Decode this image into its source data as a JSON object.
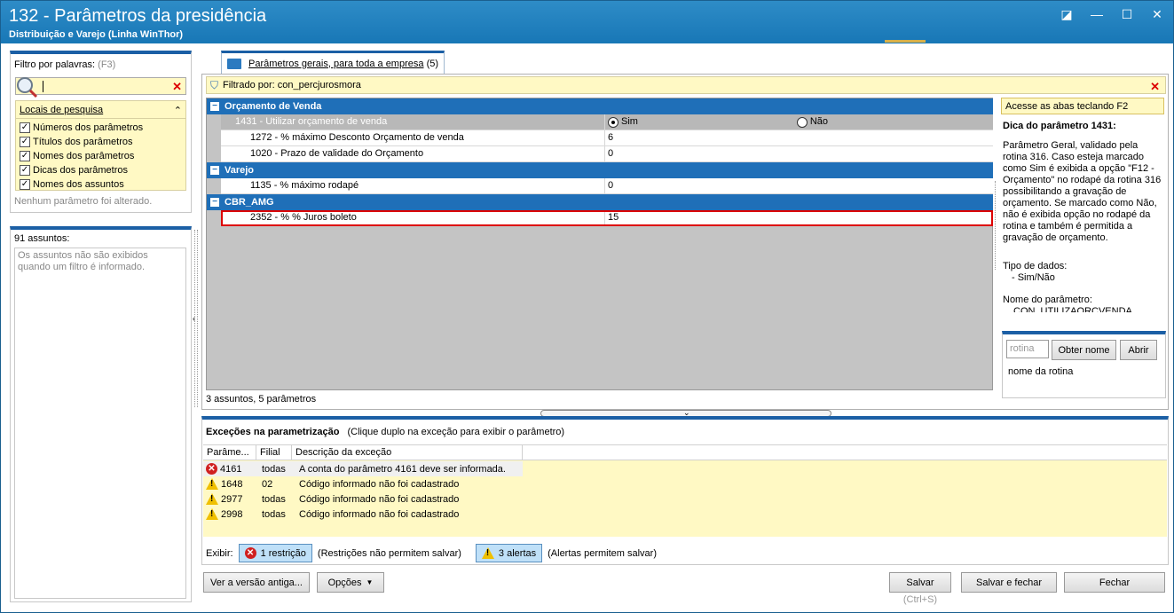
{
  "window": {
    "title": "132 - Parâmetros da presidência",
    "subtitle": "Distribuição e Varejo (Linha WinThor)"
  },
  "left": {
    "filter_label": "Filtro por palavras:",
    "filter_shortcut": "(F3)",
    "search_value": "",
    "locais_title": "Locais de pesquisa",
    "locais_items": [
      "Números dos parâmetros",
      "Títulos dos parâmetros",
      "Nomes dos parâmetros",
      "Dicas dos parâmetros",
      "Nomes dos assuntos"
    ],
    "status": "Nenhum parâmetro foi alterado.",
    "assuntos_label": "91 assuntos:",
    "assuntos_msg": "Os assuntos não são exibidos quando um filtro é informado."
  },
  "tab": {
    "label": "Parâmetros gerais, para toda a empresa",
    "count": "(5)"
  },
  "filter": {
    "text": "Filtrado por: con_percjurosmora"
  },
  "grid": {
    "groups": [
      {
        "name": "Orçamento  de Venda"
      },
      {
        "name": "Varejo"
      },
      {
        "name": "CBR_AMG"
      }
    ],
    "rows": [
      {
        "name": "1431 - Utilizar orçamento de venda",
        "val": ""
      },
      {
        "name": "1272 - % máximo Desconto Orçamento de venda",
        "val": "6"
      },
      {
        "name": "1020 - Prazo de validade do Orçamento",
        "val": "0"
      },
      {
        "name": "1135 - % máximo rodapé",
        "val": "0"
      },
      {
        "name": "2352 - % % Juros boleto",
        "val": "15"
      }
    ],
    "radio_sim": "Sim",
    "radio_nao": "Não",
    "footer": "3 assuntos, 5 parâmetros"
  },
  "hint": {
    "access": "Acesse as abas teclando F2",
    "title": "Dica do parâmetro 1431:",
    "body": "Parâmetro Geral, validado pela rotina 316. Caso esteja marcado como Sim é exibida a opção \"F12 - Orçamento\" no rodapé da rotina 316 possibilitando a gravação de orçamento. Se marcado como Não, não é exibida opção no rodapé da rotina e também é permitida a gravação de orçamento.",
    "tipo_label": "Tipo de dados:",
    "tipo_value": "- Sim/Não",
    "nome_label": "Nome do parâmetro:",
    "nome_value": "CON_UTILIZAORCVENDA"
  },
  "rotina": {
    "placeholder": "rotina",
    "obter_button": "Obter nome",
    "abrir_button": "Abrir",
    "nome_label": "nome da rotina"
  },
  "exceptions": {
    "title": "Exceções na parametrização",
    "hint": "(Clique duplo na exceção para exibir o parâmetro)",
    "columns": [
      "Parâme...",
      "Filial",
      "Descrição da exceção"
    ],
    "rows": [
      {
        "type": "error",
        "param": "4161",
        "filial": "todas",
        "desc": "A conta do parâmetro 4161 deve ser informada."
      },
      {
        "type": "warning",
        "param": "1648",
        "filial": "02",
        "desc": "Código informado não foi cadastrado"
      },
      {
        "type": "warning",
        "param": "2977",
        "filial": "todas",
        "desc": "Código informado não foi cadastrado"
      },
      {
        "type": "warning",
        "param": "2998",
        "filial": "todas",
        "desc": "Código informado não foi cadastrado"
      }
    ],
    "exibir_label": "Exibir:",
    "restricao_button": "1 restrição",
    "restricao_note": "(Restrições não permitem salvar)",
    "alertas_button": "3 alertas",
    "alertas_note": "(Alertas permitem salvar)"
  },
  "bottom": {
    "ver_versao": "Ver a versão antiga...",
    "opcoes": "Opções",
    "salvar": "Salvar",
    "salvar_shortcut": "(Ctrl+S)",
    "salvar_fechar": "Salvar e fechar",
    "fechar": "Fechar"
  }
}
